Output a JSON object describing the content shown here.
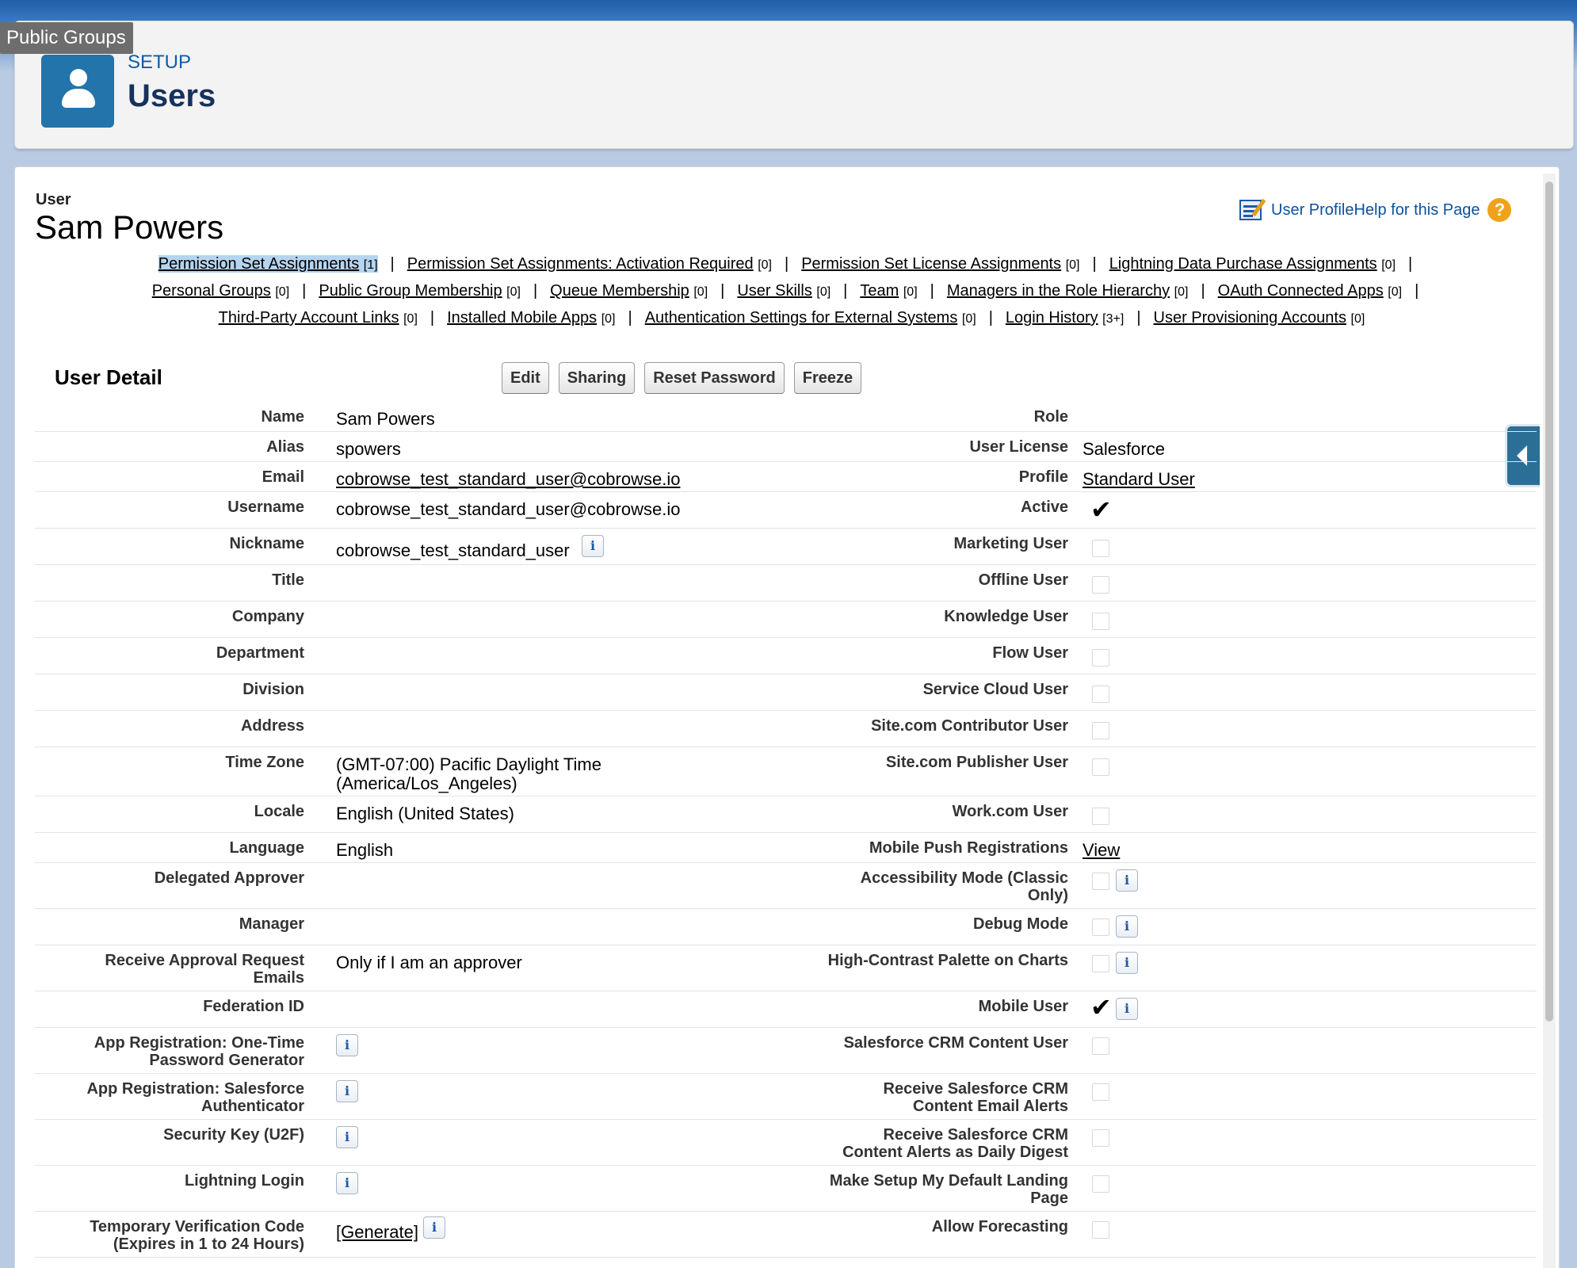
{
  "tooltip": "Public Groups",
  "header": {
    "setup_label": "SETUP",
    "title": "Users"
  },
  "record": {
    "type_label": "User",
    "name": "Sam Powers"
  },
  "page_help": {
    "profile_link": "User Profile",
    "help_link": "Help for this Page",
    "help_icon": "?"
  },
  "related_lists": [
    [
      {
        "label": "Permission Set Assignments",
        "count": "[1]"
      },
      {
        "label": "Permission Set Assignments: Activation Required",
        "count": "[0]"
      },
      {
        "label": "Permission Set License Assignments",
        "count": "[0]"
      },
      {
        "label": "Lightning Data Purchase Assignments",
        "count": "[0]"
      }
    ],
    [
      {
        "label": "Personal Groups",
        "count": "[0]"
      },
      {
        "label": "Public Group Membership",
        "count": "[0]"
      },
      {
        "label": "Queue Membership",
        "count": "[0]"
      },
      {
        "label": "User Skills",
        "count": "[0]"
      },
      {
        "label": "Team",
        "count": "[0]"
      },
      {
        "label": "Managers in the Role Hierarchy",
        "count": "[0]"
      },
      {
        "label": "OAuth Connected Apps",
        "count": "[0]"
      }
    ],
    [
      {
        "label": "Third-Party Account Links",
        "count": "[0]"
      },
      {
        "label": "Installed Mobile Apps",
        "count": "[0]"
      },
      {
        "label": "Authentication Settings for External Systems",
        "count": "[0]"
      },
      {
        "label": "Login History",
        "count": "[3+]"
      },
      {
        "label": "User Provisioning Accounts",
        "count": "[0]"
      }
    ]
  ],
  "section": {
    "title": "User Detail"
  },
  "buttons": {
    "edit": "Edit",
    "sharing": "Sharing",
    "reset_password": "Reset Password",
    "freeze": "Freeze"
  },
  "info_glyph": "i",
  "check_glyph": "✔",
  "fields": {
    "name": {
      "label": "Name",
      "value": "Sam Powers"
    },
    "alias": {
      "label": "Alias",
      "value": "spowers"
    },
    "email": {
      "label": "Email",
      "value": "cobrowse_test_standard_user@cobrowse.io"
    },
    "username": {
      "label": "Username",
      "value": "cobrowse_test_standard_user@cobrowse.io"
    },
    "nickname": {
      "label": "Nickname",
      "value": "cobrowse_test_standard_user"
    },
    "title": {
      "label": "Title",
      "value": ""
    },
    "company": {
      "label": "Company",
      "value": ""
    },
    "department": {
      "label": "Department",
      "value": ""
    },
    "division": {
      "label": "Division",
      "value": ""
    },
    "address": {
      "label": "Address",
      "value": ""
    },
    "time_zone": {
      "label": "Time Zone",
      "value_line1": "(GMT-07:00) Pacific Daylight Time",
      "value_line2": "(America/Los_Angeles)"
    },
    "locale": {
      "label": "Locale",
      "value": "English (United States)"
    },
    "language": {
      "label": "Language",
      "value": "English"
    },
    "delegated_approver": {
      "label": "Delegated Approver",
      "value": ""
    },
    "manager": {
      "label": "Manager",
      "value": ""
    },
    "receive_approval": {
      "label_line1": "Receive Approval Request",
      "label_line2": "Emails",
      "value": "Only if I am an approver"
    },
    "federation_id": {
      "label": "Federation ID",
      "value": ""
    },
    "app_reg_otp": {
      "label_line1": "App Registration: One-Time",
      "label_line2": "Password Generator"
    },
    "app_reg_sf_auth": {
      "label_line1": "App Registration: Salesforce",
      "label_line2": "Authenticator"
    },
    "security_key": {
      "label": "Security Key (U2F)"
    },
    "lightning_login": {
      "label": "Lightning Login"
    },
    "temp_code": {
      "label_line1": "Temporary Verification Code",
      "label_line2": "(Expires in 1 to 24 Hours)",
      "value": "[Generate]"
    },
    "role": {
      "label": "Role",
      "value": ""
    },
    "user_license": {
      "label": "User License",
      "value": "Salesforce"
    },
    "profile": {
      "label": "Profile",
      "value": "Standard User"
    },
    "active": {
      "label": "Active",
      "checked": true
    },
    "marketing_user": {
      "label": "Marketing User",
      "checked": false
    },
    "offline_user": {
      "label": "Offline User",
      "checked": false
    },
    "knowledge_user": {
      "label": "Knowledge User",
      "checked": false
    },
    "flow_user": {
      "label": "Flow User",
      "checked": false
    },
    "service_cloud_user": {
      "label": "Service Cloud User",
      "checked": false
    },
    "site_contributor": {
      "label": "Site.com Contributor User",
      "checked": false
    },
    "site_publisher": {
      "label": "Site.com Publisher User",
      "checked": false
    },
    "workcom_user": {
      "label": "Work.com User",
      "checked": false
    },
    "mobile_push": {
      "label": "Mobile Push Registrations",
      "value": "View"
    },
    "accessibility_mode": {
      "label_line1": "Accessibility Mode (Classic",
      "label_line2": "Only)",
      "checked": false
    },
    "debug_mode": {
      "label": "Debug Mode",
      "checked": false
    },
    "high_contrast": {
      "label": "High-Contrast Palette on Charts",
      "checked": false
    },
    "mobile_user": {
      "label": "Mobile User",
      "checked": true
    },
    "crm_content_user": {
      "label": "Salesforce CRM Content User",
      "checked": false
    },
    "crm_email_alerts": {
      "label_line1": "Receive Salesforce CRM",
      "label_line2": "Content Email Alerts",
      "checked": false
    },
    "crm_daily_digest": {
      "label_line1": "Receive Salesforce CRM",
      "label_line2": "Content Alerts as Daily Digest",
      "checked": false
    },
    "setup_landing": {
      "label_line1": "Make Setup My Default Landing",
      "label_line2": "Page",
      "checked": false
    },
    "allow_forecasting": {
      "label": "Allow Forecasting",
      "checked": false
    }
  }
}
